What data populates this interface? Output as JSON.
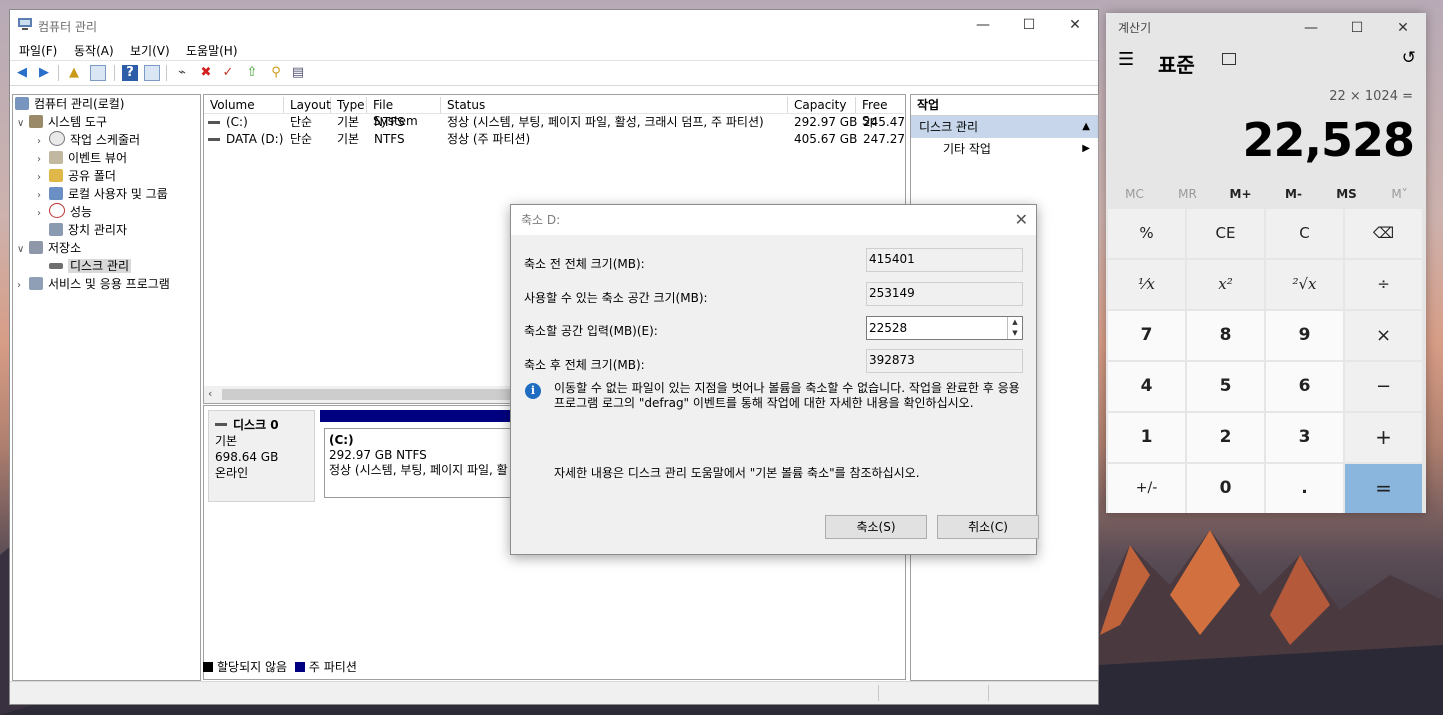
{
  "computer_management": {
    "window_title": "컴퓨터 관리",
    "menu": [
      "파일(F)",
      "동작(A)",
      "보기(V)",
      "도움말(H)"
    ],
    "tree": [
      {
        "label": "컴퓨터 관리(로컬)",
        "icon": "computer-management-icon"
      },
      {
        "label": "시스템 도구",
        "icon": "tools-icon"
      },
      {
        "label": "작업 스케줄러",
        "icon": "clock-icon"
      },
      {
        "label": "이벤트 뷰어",
        "icon": "event-viewer-icon"
      },
      {
        "label": "공유 폴더",
        "icon": "shared-folder-icon"
      },
      {
        "label": "로컬 사용자 및 그룹",
        "icon": "users-icon"
      },
      {
        "label": "성능",
        "icon": "performance-icon"
      },
      {
        "label": "장치 관리자",
        "icon": "device-manager-icon"
      },
      {
        "label": "저장소",
        "icon": "storage-icon"
      },
      {
        "label": "디스크 관리",
        "icon": "disk-icon"
      },
      {
        "label": "서비스 및 응용 프로그램",
        "icon": "services-icon"
      }
    ],
    "columns": [
      "Volume",
      "Layout",
      "Type",
      "File System",
      "Status",
      "Capacity",
      "Free Sp"
    ],
    "volumes": [
      {
        "volume": "(C:)",
        "layout": "단순",
        "type": "기본",
        "fs": "NTFS",
        "status": "정상 (시스템, 부팅, 페이지 파일, 활성, 크래시 덤프, 주 파티션)",
        "capacity": "292.97 GB",
        "free": "245.47"
      },
      {
        "volume": "DATA (D:)",
        "layout": "단순",
        "type": "기본",
        "fs": "NTFS",
        "status": "정상 (주 파티션)",
        "capacity": "405.67 GB",
        "free": "247.27"
      }
    ],
    "disk": {
      "name": "디스크 0",
      "type": "기본",
      "size": "698.64 GB",
      "state": "온라인",
      "part_name": "(C:)",
      "part_size": "292.97 GB NTFS",
      "part_status": "정상 (시스템, 부팅, 페이지 파일, 활"
    },
    "legend": {
      "unallocated": "할당되지 않음",
      "primary": "주 파티션"
    },
    "actions": {
      "header": "작업",
      "section": "디스크 관리",
      "more": "기타 작업"
    }
  },
  "shrink_dialog": {
    "title": "축소 D:",
    "total_before_label": "축소 전 전체 크기(MB):",
    "total_before": "415401",
    "available_label": "사용할 수 있는 축소 공간 크기(MB):",
    "available": "253149",
    "input_label": "축소할 공간 입력(MB)(E):",
    "input_value": "22528",
    "total_after_label": "축소 후 전체 크기(MB):",
    "total_after": "392873",
    "info": "이동할 수 없는 파일이 있는 지점을 벗어나 볼륨을 축소할 수 없습니다. 작업을 완료한 후 응용 프로그램 로그의 \"defrag\" 이벤트를 통해 작업에 대한 자세한 내용을 확인하십시오.",
    "help": "자세한 내용은 디스크 관리 도움말에서 \"기본 볼륨 축소\"를 참조하십시오.",
    "shrink_button": "축소(S)",
    "cancel_button": "취소(C)"
  },
  "calculator": {
    "window_title": "계산기",
    "mode": "표준",
    "expression": "22 × 1024 =",
    "display": "22,528",
    "memory": [
      "MC",
      "MR",
      "M+",
      "M-",
      "MS",
      "M˅"
    ],
    "keys": [
      [
        "%",
        "CE",
        "C",
        "⌫"
      ],
      [
        "¹⁄x",
        "x²",
        "²√x",
        "÷"
      ],
      [
        "7",
        "8",
        "9",
        "×"
      ],
      [
        "4",
        "5",
        "6",
        "−"
      ],
      [
        "1",
        "2",
        "3",
        "+"
      ],
      [
        "+/-",
        "0",
        ".",
        "="
      ]
    ],
    "accent": "#8ab6de"
  }
}
